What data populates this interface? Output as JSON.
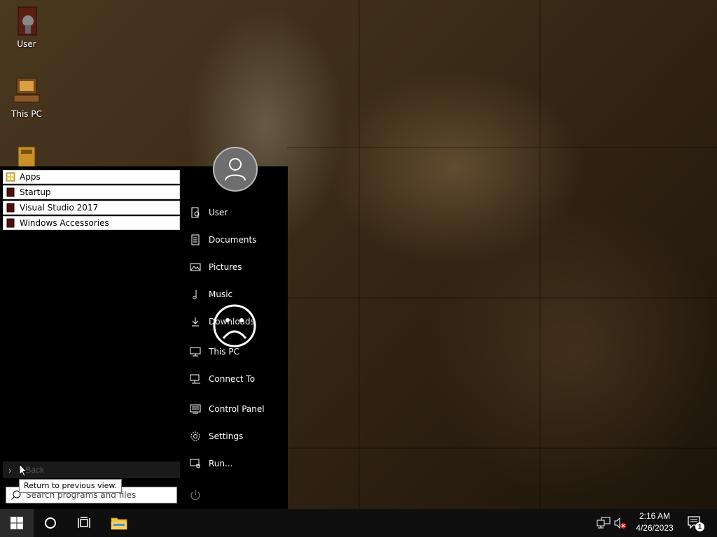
{
  "desktop": {
    "icons": [
      {
        "label": "User"
      },
      {
        "label": "This PC"
      },
      {
        "label": ""
      }
    ]
  },
  "start_menu": {
    "folders": [
      {
        "label": "Apps"
      },
      {
        "label": "Startup"
      },
      {
        "label": "Visual Studio 2017"
      },
      {
        "label": "Windows Accessories"
      }
    ],
    "places": [
      {
        "label": "User",
        "icon": "user-folder-icon"
      },
      {
        "label": "Documents",
        "icon": "document-icon"
      },
      {
        "label": "Pictures",
        "icon": "picture-icon"
      },
      {
        "label": "Music",
        "icon": "music-note-icon"
      },
      {
        "label": "Downloads",
        "icon": "download-icon"
      },
      {
        "label": "This PC",
        "icon": "computer-icon"
      },
      {
        "label": "Connect To",
        "icon": "network-icon"
      },
      {
        "label": "Control Panel",
        "icon": "control-panel-icon"
      },
      {
        "label": "Settings",
        "icon": "gear-icon"
      },
      {
        "label": "Run...",
        "icon": "run-icon"
      }
    ],
    "back_label": "Back",
    "tooltip": "Return to previous view.",
    "search_placeholder": "Search programs and files"
  },
  "taskbar": {
    "time": "2:16 AM",
    "date": "4/26/2023",
    "notification_count": "1"
  }
}
